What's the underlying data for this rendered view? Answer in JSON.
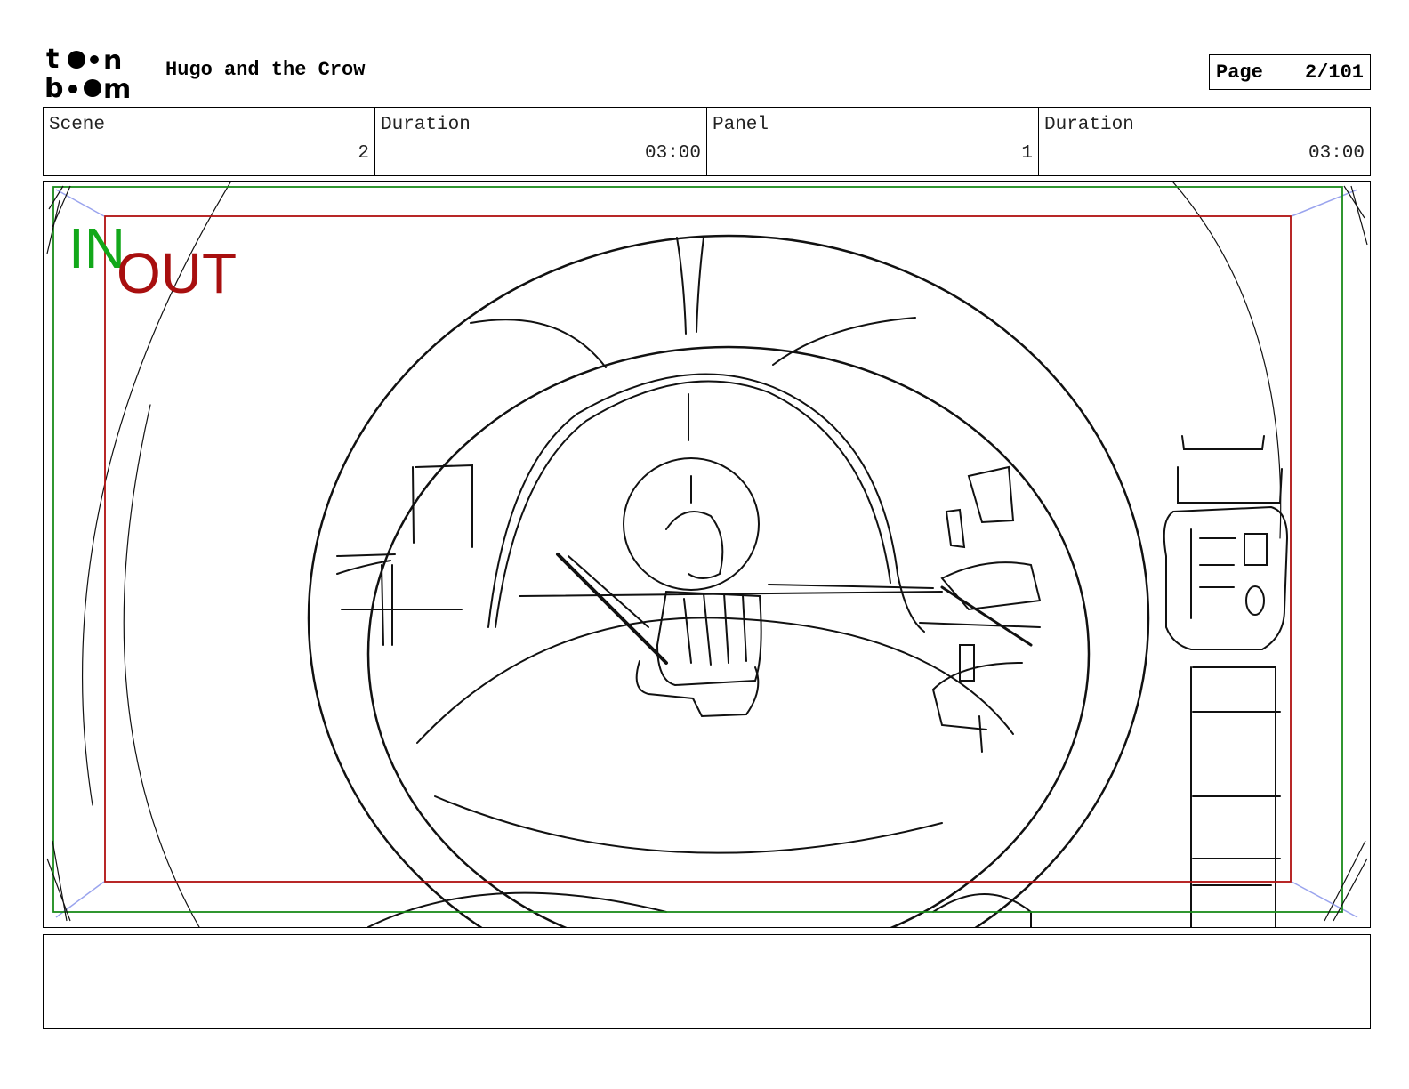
{
  "header": {
    "logo_text_top": "toon",
    "logo_text_bottom": "boom",
    "project_title": "Hugo and the Crow",
    "page_label": "Page",
    "page_value": "2/101"
  },
  "info": {
    "scene_label": "Scene",
    "scene_value": "2",
    "scene_duration_label": "Duration",
    "scene_duration_value": "03:00",
    "panel_label": "Panel",
    "panel_value": "1",
    "panel_duration_label": "Duration",
    "panel_duration_value": "03:00"
  },
  "panel": {
    "in_label": "IN",
    "out_label": "OUT",
    "colors": {
      "in_frame": "#1a8a1a",
      "out_frame": "#b01010",
      "in_text": "#12a81a",
      "out_text": "#a80f0f",
      "corner_arrows": "#9aa4ee"
    }
  },
  "notes": {
    "text": ""
  }
}
